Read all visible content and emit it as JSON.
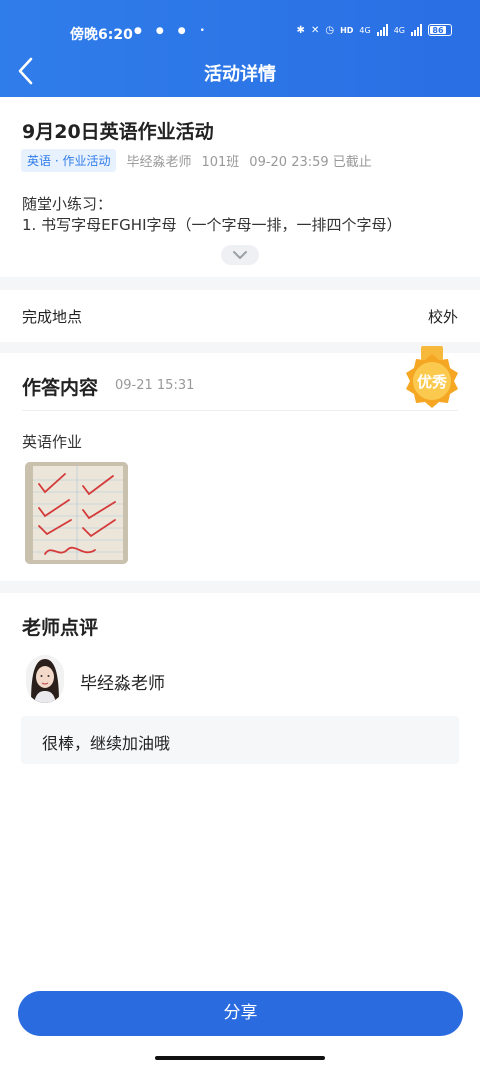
{
  "status_bar": {
    "time": "傍晚6:20",
    "battery": "86",
    "net1": "4G",
    "net2": "4G",
    "hd": "HD"
  },
  "header": {
    "title": "活动详情"
  },
  "activity": {
    "title": "9月20日英语作业活动",
    "tag": "英语 · 作业活动",
    "teacher": "毕经淼老师",
    "class": "101班",
    "deadline": "09-20 23:59 已截止",
    "desc_line1": "随堂小练习：",
    "desc_line2": "1. 书写字母EFGHI字母（一个字母一排，一排四个字母）"
  },
  "location": {
    "label": "完成地点",
    "value": "校外"
  },
  "answer": {
    "title": "作答内容",
    "time": "09-21 15:31",
    "homework_label": "英语作业",
    "medal_text": "优秀"
  },
  "comment_section": {
    "title": "老师点评",
    "teacher_name": "毕经淼老师",
    "comment": "很棒，继续加油哦"
  },
  "footer": {
    "share_label": "分享"
  },
  "colors": {
    "brand": "#2a6fe4",
    "tag_bg": "#e8f1fe",
    "medal": "#f5a623"
  }
}
